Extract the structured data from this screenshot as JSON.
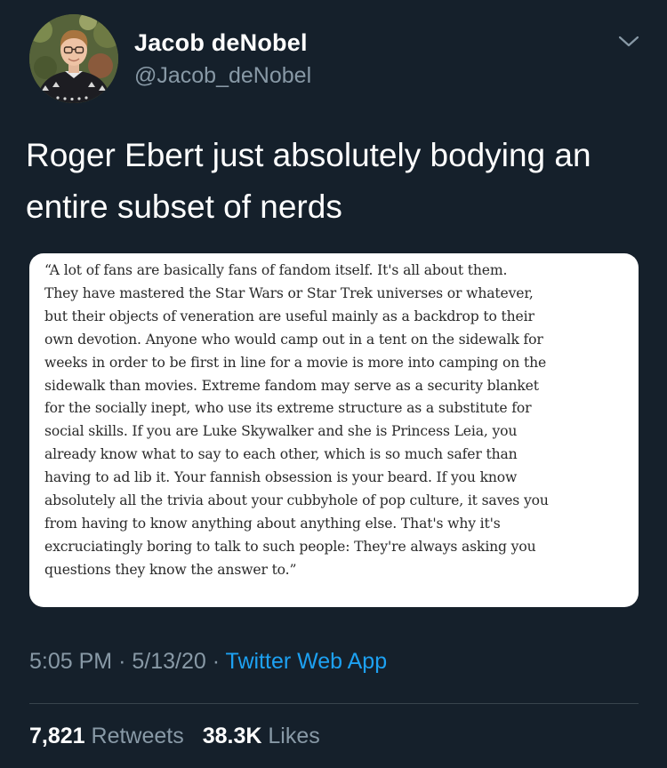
{
  "theme": {
    "background": "#15202b",
    "primary_text": "#ffffff",
    "secondary_text": "#8899a6",
    "link": "#1da1f2",
    "divider": "#38444d"
  },
  "author": {
    "display_name": "Jacob deNobel",
    "handle": "@Jacob_deNobel",
    "avatar_icon": "profile-photo",
    "menu_icon": "chevron-down-icon"
  },
  "tweet": {
    "text": "Roger Ebert just absolutely bodying an entire subset of nerds",
    "quote_image_text": "“A lot of fans are basically fans of fandom itself. It's all about them.\nThey have mastered the Star Wars or Star Trek universes or whatever,\nbut their objects of veneration are useful mainly as a backdrop to their\nown devotion. Anyone who would camp out in a tent on the sidewalk for\nweeks in order to be first in line for a movie is more into camping on the\nsidewalk than movies. Extreme fandom may serve as a security blanket\nfor the socially inept, who use its extreme structure as a substitute for\nsocial skills. If you are Luke Skywalker and she is Princess Leia, you\nalready know what to say to each other, which is so much safer than\nhaving to ad lib it. Your fannish obsession is your beard. If you know\nabsolutely all the trivia about your cubbyhole of pop culture, it saves you\nfrom having to know anything about anything else. That's why it's\nexcruciatingly boring to talk to such people: They're always asking you\nquestions they know the answer to.”"
  },
  "meta": {
    "time": "5:05 PM",
    "date": "5/13/20",
    "separator": "·",
    "source": "Twitter Web App"
  },
  "stats": {
    "retweets_count": "7,821",
    "retweets_label": "Retweets",
    "likes_count": "38.3K",
    "likes_label": "Likes"
  }
}
